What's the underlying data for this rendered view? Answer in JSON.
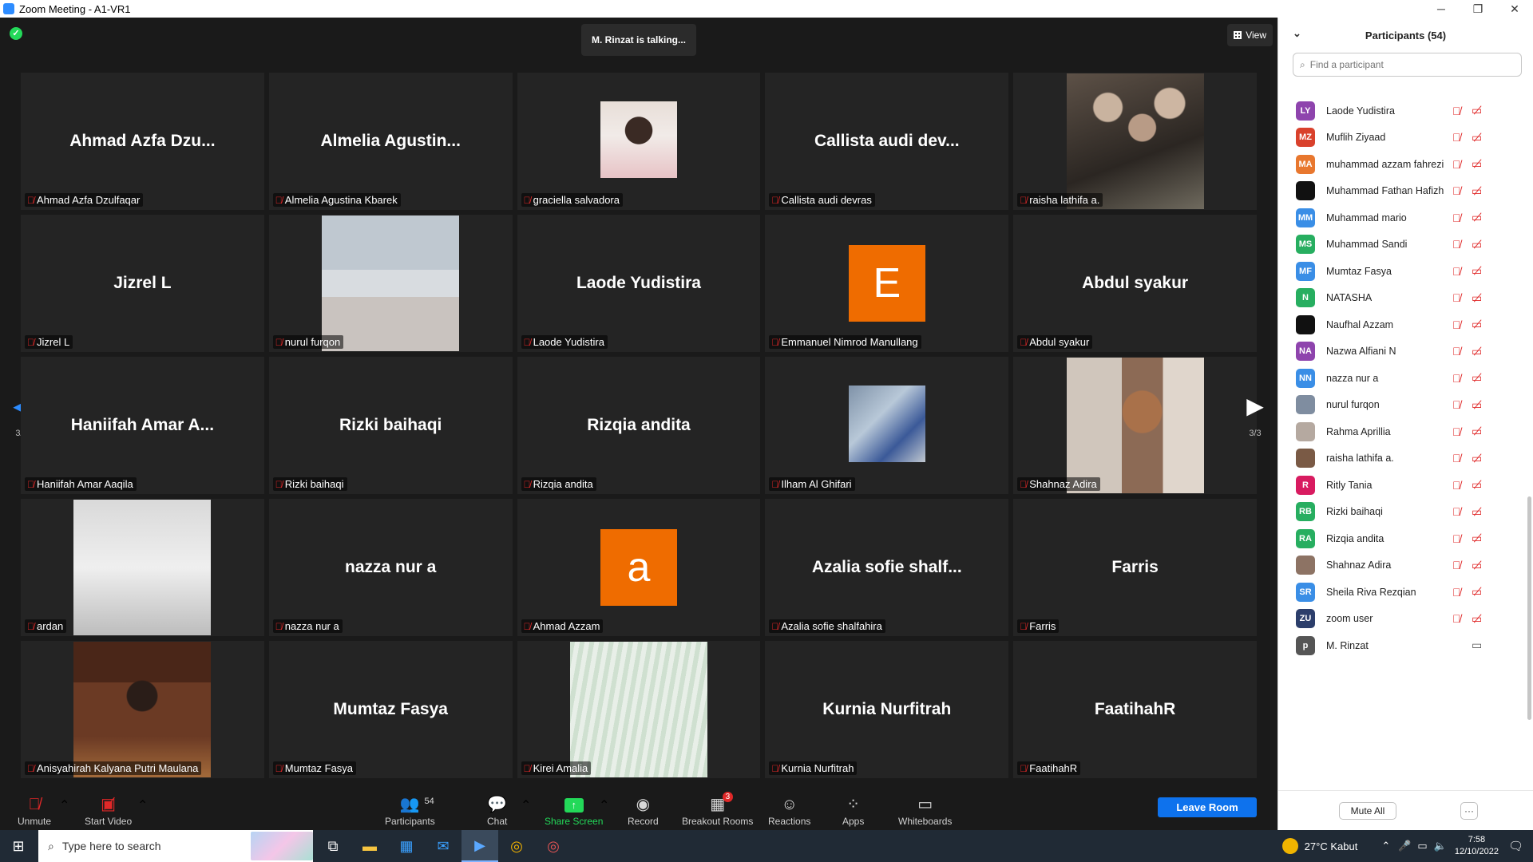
{
  "window": {
    "title": "Zoom Meeting - A1-VR1",
    "minimize": "─",
    "maximize": "❐",
    "close": "✕"
  },
  "meeting": {
    "talking": "M. Rinzat is talking...",
    "view_label": "View",
    "page_indicator": "3/3",
    "tiles": [
      {
        "big": "Ahmad Azfa Dzu...",
        "label": "Ahmad Azfa Dzulfaqar",
        "kind": "name"
      },
      {
        "big": "Almelia  Agustin...",
        "label": "Almelia Agustina Kbarek",
        "kind": "name"
      },
      {
        "big": "",
        "label": "graciella salvadora",
        "kind": "photo-small",
        "photo": "portrait"
      },
      {
        "big": "Callista audi dev...",
        "label": "Callista audi devras",
        "kind": "name"
      },
      {
        "big": "",
        "label": "raisha lathifa a.",
        "kind": "photo",
        "photo": "group"
      },
      {
        "big": "Jizrel L",
        "label": "Jizrel L",
        "kind": "name"
      },
      {
        "big": "",
        "label": "nurul furqon",
        "kind": "photo",
        "photo": "motorbike"
      },
      {
        "big": "Laode Yudistira",
        "label": "Laode Yudistira",
        "kind": "name"
      },
      {
        "big": "E",
        "label": "Emmanuel Nimrod Manullang",
        "kind": "letter"
      },
      {
        "big": "Abdul syakur",
        "label": "Abdul syakur",
        "kind": "name"
      },
      {
        "big": "Haniifah Amar A...",
        "label": "Haniifah Amar Aaqila",
        "kind": "name"
      },
      {
        "big": "Rizki baihaqi",
        "label": "Rizki baihaqi",
        "kind": "name"
      },
      {
        "big": "Rizqia andita",
        "label": "Rizqia andita",
        "kind": "name"
      },
      {
        "big": "",
        "label": "Ilham Al Ghifari",
        "kind": "photo-small",
        "photo": "room"
      },
      {
        "big": "",
        "label": "Shahnaz Adira",
        "kind": "photo",
        "photo": "teddy"
      },
      {
        "big": "",
        "label": "ardan",
        "kind": "photo",
        "photo": "shirt"
      },
      {
        "big": "nazza nur a",
        "label": "nazza nur a",
        "kind": "name"
      },
      {
        "big": "a",
        "label": "Ahmad Azzam",
        "kind": "letter"
      },
      {
        "big": "Azalia sofie shalf...",
        "label": "Azalia sofie shalfahira",
        "kind": "name"
      },
      {
        "big": "Farris",
        "label": "Farris",
        "kind": "name"
      },
      {
        "big": "",
        "label": "Anisyahirah Kalyana Putri Maulana",
        "kind": "photo",
        "photo": "office"
      },
      {
        "big": "Mumtaz Fasya",
        "label": "Mumtaz Fasya",
        "kind": "name"
      },
      {
        "big": "",
        "label": "Kirei Amalia",
        "kind": "photo",
        "photo": "stripes"
      },
      {
        "big": "Kurnia Nurfitrah",
        "label": "Kurnia Nurfitrah",
        "kind": "name"
      },
      {
        "big": "FaatihahR",
        "label": "FaatihahR",
        "kind": "name"
      }
    ]
  },
  "toolbar": {
    "unmute": "Unmute",
    "start_video": "Start Video",
    "participants": "Participants",
    "participants_count": "54",
    "chat": "Chat",
    "share_screen": "Share Screen",
    "record": "Record",
    "breakout_rooms": "Breakout Rooms",
    "breakout_badge": "3",
    "reactions": "Reactions",
    "apps": "Apps",
    "whiteboards": "Whiteboards",
    "leave_room": "Leave Room"
  },
  "panel": {
    "title": "Participants (54)",
    "search_placeholder": "Find a participant",
    "mute_all": "Mute All",
    "more": "···",
    "participants": [
      {
        "initials": "LY",
        "name": "Laode Yudistira",
        "color": "#8e44ad",
        "video": "off"
      },
      {
        "initials": "MZ",
        "name": "Muflih Ziyaad",
        "color": "#d9412c",
        "video": "off"
      },
      {
        "initials": "MA",
        "name": "muhammad azzam fahrezi",
        "color": "#e8772e",
        "video": "off"
      },
      {
        "initials": "",
        "name": "Muhammad Fathan Hafizh",
        "color": "#111111",
        "video": "off"
      },
      {
        "initials": "MM",
        "name": "Muhammad mario",
        "color": "#3a8ee6",
        "video": "off"
      },
      {
        "initials": "MS",
        "name": "Muhammad Sandi",
        "color": "#27ae60",
        "video": "off"
      },
      {
        "initials": "MF",
        "name": "Mumtaz Fasya",
        "color": "#3a8ee6",
        "video": "off"
      },
      {
        "initials": "N",
        "name": "NATASHA",
        "color": "#27ae60",
        "video": "off"
      },
      {
        "initials": "",
        "name": "Naufhal Azzam",
        "color": "#111111",
        "video": "off"
      },
      {
        "initials": "NA",
        "name": "Nazwa Alfiani N",
        "color": "#8e44ad",
        "video": "off"
      },
      {
        "initials": "NN",
        "name": "nazza nur a",
        "color": "#3a8ee6",
        "video": "off"
      },
      {
        "initials": "",
        "name": "nurul furqon",
        "color": "#7f8da0",
        "video": "off"
      },
      {
        "initials": "",
        "name": "Rahma Aprillia",
        "color": "#b5a9a0",
        "video": "off"
      },
      {
        "initials": "",
        "name": "raisha lathifa a.",
        "color": "#7a5a45",
        "video": "off"
      },
      {
        "initials": "R",
        "name": "Ritly Tania",
        "color": "#d81b60",
        "video": "off"
      },
      {
        "initials": "RB",
        "name": "Rizki baihaqi",
        "color": "#27ae60",
        "video": "off"
      },
      {
        "initials": "RA",
        "name": "Rizqia andita",
        "color": "#27ae60",
        "video": "off"
      },
      {
        "initials": "",
        "name": "Shahnaz Adira",
        "color": "#8d7364",
        "video": "off"
      },
      {
        "initials": "SR",
        "name": "Sheila Riva Rezqian",
        "color": "#3a8ee6",
        "video": "off"
      },
      {
        "initials": "ZU",
        "name": "zoom user",
        "color": "#2c3e6b",
        "video": "off"
      },
      {
        "initials": "p",
        "name": "M. Rinzat",
        "color": "#555555",
        "video": "on"
      }
    ]
  },
  "taskbar": {
    "search_placeholder": "Type here to search",
    "weather": "27°C  Kabut",
    "time": "7:58",
    "date": "12/10/2022"
  },
  "colors": {
    "accent": "#2d8cff",
    "leave": "#0e72ed",
    "muted": "#e02828",
    "share": "#23d959",
    "letter_avatar": "#ef6c00"
  }
}
